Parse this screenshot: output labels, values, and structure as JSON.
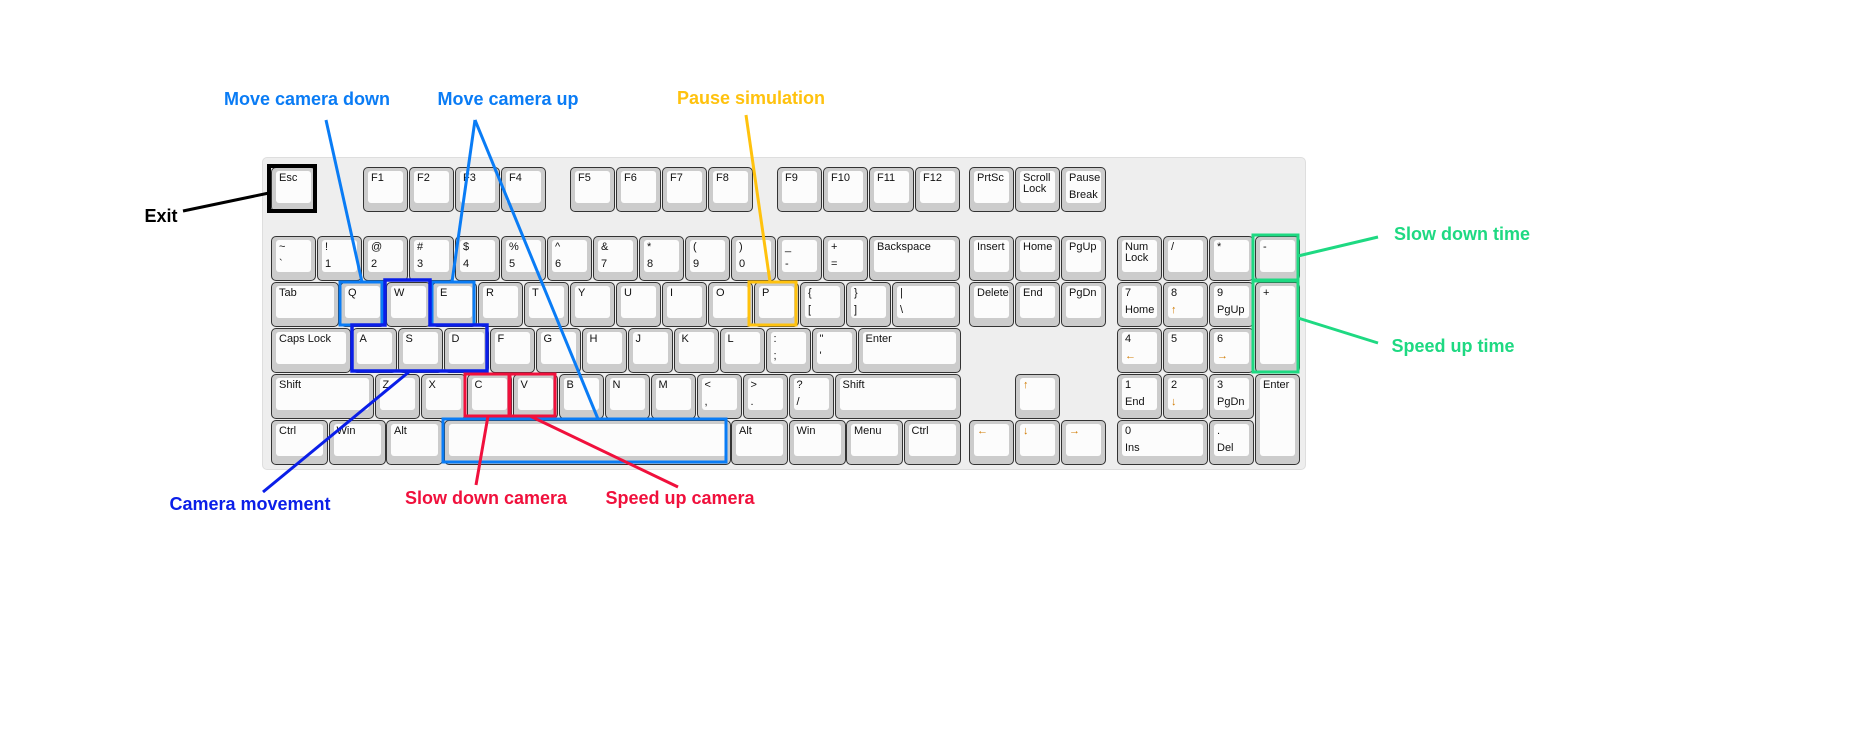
{
  "colors": {
    "exit": "#000000",
    "camera_updown": "#0a7cf5",
    "camera_movement": "#0a1ee8",
    "camera_speed": "#f0103c",
    "pause": "#ffc20e",
    "time": "#1ed982"
  },
  "annotations": {
    "exit": "Exit",
    "move_camera_down": "Move camera down",
    "move_camera_up": "Move camera up",
    "pause_simulation": "Pause simulation",
    "camera_movement": "Camera movement",
    "slow_down_camera": "Slow down camera",
    "speed_up_camera": "Speed up camera",
    "slow_down_time": "Slow down time",
    "speed_up_time": "Speed up time"
  },
  "keys": [
    {
      "top": "Esc"
    },
    {
      "top": "F1"
    },
    {
      "top": "F2"
    },
    {
      "top": "F3"
    },
    {
      "top": "F4"
    },
    {
      "top": "F5"
    },
    {
      "top": "F6"
    },
    {
      "top": "F7"
    },
    {
      "top": "F8"
    },
    {
      "top": "F9"
    },
    {
      "top": "F10"
    },
    {
      "top": "F11"
    },
    {
      "top": "F12"
    },
    {
      "top": "PrtSc"
    },
    {
      "top": "Scroll\nLock"
    },
    {
      "top": "Pause",
      "bottom": "Break"
    },
    {
      "top": "~",
      "bottom": "`"
    },
    {
      "top": "!",
      "bottom": "1"
    },
    {
      "top": "@",
      "bottom": "2"
    },
    {
      "top": "#",
      "bottom": "3"
    },
    {
      "top": "$",
      "bottom": "4"
    },
    {
      "top": "%",
      "bottom": "5"
    },
    {
      "top": "^",
      "bottom": "6"
    },
    {
      "top": "&",
      "bottom": "7"
    },
    {
      "top": "*",
      "bottom": "8"
    },
    {
      "top": "(",
      "bottom": "9"
    },
    {
      "top": ")",
      "bottom": "0"
    },
    {
      "top": "_",
      "bottom": "-"
    },
    {
      "top": "+",
      "bottom": "="
    },
    {
      "top": "Backspace"
    },
    {
      "top": "Insert"
    },
    {
      "top": "Home"
    },
    {
      "top": "PgUp"
    },
    {
      "top": "Num\nLock"
    },
    {
      "top": "/"
    },
    {
      "top": "*"
    },
    {
      "top": "-"
    },
    {
      "top": "Tab"
    },
    {
      "top": "Q"
    },
    {
      "top": "W"
    },
    {
      "top": "E"
    },
    {
      "top": "R"
    },
    {
      "top": "T"
    },
    {
      "top": "Y"
    },
    {
      "top": "U"
    },
    {
      "top": "I"
    },
    {
      "top": "O"
    },
    {
      "top": "P"
    },
    {
      "top": "{",
      "bottom": "["
    },
    {
      "top": "}",
      "bottom": "]"
    },
    {
      "top": "|",
      "bottom": "\\"
    },
    {
      "top": "Delete"
    },
    {
      "top": "End"
    },
    {
      "top": "PgDn"
    },
    {
      "top": "7",
      "bottom": "Home"
    },
    {
      "top": "8",
      "bottom": "↑"
    },
    {
      "top": "9",
      "bottom": "PgUp"
    },
    {
      "top": "+"
    },
    {
      "top": "Caps Lock"
    },
    {
      "top": "A"
    },
    {
      "top": "S"
    },
    {
      "top": "D"
    },
    {
      "top": "F"
    },
    {
      "top": "G"
    },
    {
      "top": "H"
    },
    {
      "top": "J"
    },
    {
      "top": "K"
    },
    {
      "top": "L"
    },
    {
      "top": ":",
      "bottom": ";"
    },
    {
      "top": "\"",
      "bottom": "'"
    },
    {
      "top": "Enter"
    },
    {
      "top": "4",
      "bottom": "←"
    },
    {
      "top": "5"
    },
    {
      "top": "6",
      "bottom": "→"
    },
    {
      "top": "Shift"
    },
    {
      "top": "Z"
    },
    {
      "top": "X"
    },
    {
      "top": "C"
    },
    {
      "top": "V"
    },
    {
      "top": "B"
    },
    {
      "top": "N"
    },
    {
      "top": "M"
    },
    {
      "top": "<",
      "bottom": ","
    },
    {
      "top": ">",
      "bottom": "."
    },
    {
      "top": "?",
      "bottom": "/"
    },
    {
      "top": "Shift"
    },
    {
      "top": "↑"
    },
    {
      "top": "1",
      "bottom": "End"
    },
    {
      "top": "2",
      "bottom": "↓"
    },
    {
      "top": "3",
      "bottom": "PgDn"
    },
    {
      "top": "Enter"
    },
    {
      "top": "Ctrl"
    },
    {
      "top": "Win"
    },
    {
      "top": "Alt"
    },
    {
      "top": ""
    },
    {
      "top": "Alt"
    },
    {
      "top": "Win"
    },
    {
      "top": "Menu"
    },
    {
      "top": "Ctrl"
    },
    {
      "top": "←"
    },
    {
      "top": "↓"
    },
    {
      "top": "→"
    },
    {
      "top": "0",
      "bottom": "Ins"
    },
    {
      "top": ".",
      "bottom": "Del"
    }
  ]
}
